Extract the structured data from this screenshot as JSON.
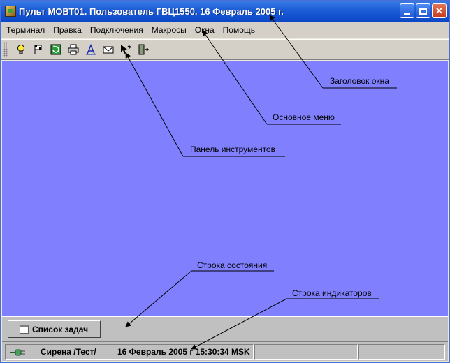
{
  "window": {
    "title": "Пульт МОВТ01. Пользователь ГВЦ1550. 16 Февраль 2005 г.",
    "icon": "app-icon",
    "buttons": {
      "minimize": "minimize-icon",
      "maximize": "maximize-icon",
      "close": "close-icon"
    }
  },
  "menu": {
    "items": [
      {
        "label": "Терминал"
      },
      {
        "label": "Правка"
      },
      {
        "label": "Подключения"
      },
      {
        "label": "Макросы"
      },
      {
        "label": "Окна"
      },
      {
        "label": "Помощь"
      }
    ]
  },
  "toolbar": {
    "icons": [
      "lightbulb-icon",
      "flags-icon",
      "refresh-icon",
      "printer-icon",
      "font-icon",
      "envelope-icon",
      "help-pointer-icon",
      "exit-icon"
    ]
  },
  "desktop": {
    "color": "#8080ff"
  },
  "taskbar": {
    "button_label": "Список задач"
  },
  "statusbar": {
    "connection_icon": "plug-icon",
    "label": "Сирена /Тест/",
    "datetime": "16 Февраль 2005 г 15:30:34 MSK",
    "indicator1": "",
    "indicator2": ""
  },
  "annotations": [
    {
      "id": "window-title",
      "label": "Заголовок окна"
    },
    {
      "id": "main-menu",
      "label": "Основное меню"
    },
    {
      "id": "toolbar",
      "label": "Панель инструментов"
    },
    {
      "id": "status-line",
      "label": "Строка состояния"
    },
    {
      "id": "indicator-line",
      "label": "Строка индикаторов"
    }
  ]
}
